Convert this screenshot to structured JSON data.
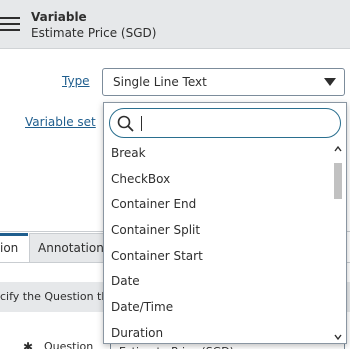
{
  "header": {
    "title": "Variable",
    "subtitle": "Estimate Price (SGD)"
  },
  "form": {
    "type_label": "Type",
    "type_value": "Single Line Text",
    "variable_set_label": "Variable set"
  },
  "tabs": [
    {
      "label": "ion",
      "active": true
    },
    {
      "label": "Annotation",
      "active": false
    }
  ],
  "info_text": "cify the Question th",
  "question_row": {
    "label": "Question",
    "value": "Estimate Price (SGD)"
  },
  "dropdown": {
    "search_value": "",
    "options": [
      "Break",
      "CheckBox",
      "Container End",
      "Container Split",
      "Container Start",
      "Date",
      "Date/Time",
      "Duration"
    ]
  },
  "icons": {
    "menu": "hamburger-icon",
    "select_arrow": "caret-down-icon",
    "search": "search-icon"
  }
}
